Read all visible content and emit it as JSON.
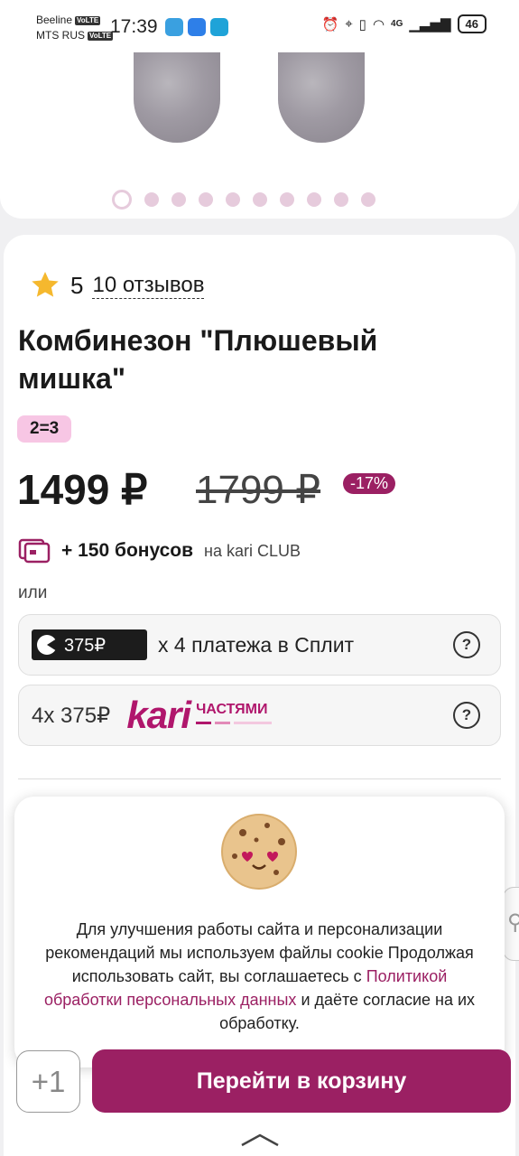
{
  "status_bar": {
    "carrier1": "Beeline",
    "carrier2": "MTS RUS",
    "volte": "VoLTE",
    "time": "17:39",
    "network": "4G",
    "battery": "46"
  },
  "gallery": {
    "dot_count": 10,
    "active_index": 0
  },
  "product": {
    "rating": "5",
    "reviews": "10 отзывов",
    "title": "Комбинезон \"Плюшевый мишка\"",
    "promo_badge": "2=3",
    "price": "1499 ₽",
    "old_price": "1799 ₽",
    "discount": "-17%",
    "bonus_amount": "+ 150 бонусов",
    "bonus_note": "на kari CLUB",
    "or_label": "или"
  },
  "payments": {
    "split_amount": "375₽",
    "split_text": "х 4 платежа в Сплит",
    "kari_amount": "4х 375₽",
    "kari_logo": "kari",
    "kari_parts": "ЧАСТЯМИ",
    "help_label": "?"
  },
  "cookie": {
    "text_before": "Для улучшения работы сайта и персонализации рекомендаций мы используем файлы cookie Продолжая использовать сайт, вы соглашаетесь с",
    "link": "Политикой обработки персональных данных",
    "text_after": "и даёте согласие на их обработку."
  },
  "bottom": {
    "plus_label": "+1",
    "cart_button": "Перейти в корзину"
  },
  "colors": {
    "brand": "#9b2063",
    "promo_bg": "#f7c6e4",
    "dot": "#e6cbdc"
  }
}
